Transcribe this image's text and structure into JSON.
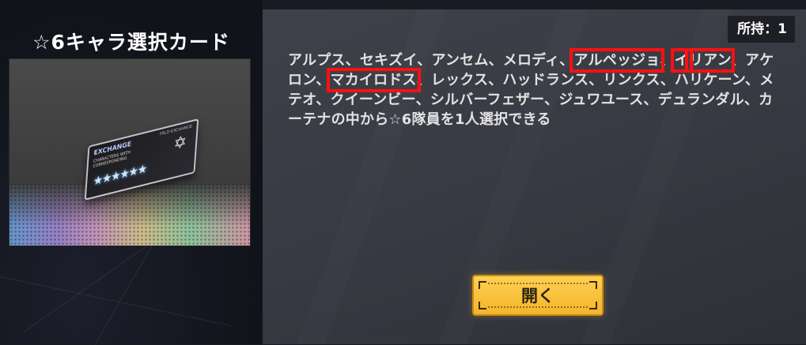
{
  "item": {
    "title": "☆6キャラ選択カード",
    "ticket_label": "EXCHANGE",
    "ticket_subtext": "CHARACTERS WITH CORRESPONDING",
    "ticket_code": "FRLD-EXCHANGE",
    "ticket_stars": "★★★★★★"
  },
  "owned": {
    "label": "所持：1"
  },
  "description": {
    "part1": "アルプス、セキズイ、アンセム、メロディ、",
    "hl1": "アルペッジョ",
    "sep1": "、",
    "hl2a": "イ",
    "hl2b": "リアン",
    "part2": "、アケロン、",
    "hl3": "マカイロドス",
    "part3": "、レックス、ハッドランス、リンクス、ハリケーン、メテオ、クイーンビー、シルバーフェザー、ジュワユース、デュランダル、カーテナの中から☆6隊員を1人選択できる"
  },
  "actions": {
    "open_label": "開く"
  },
  "colors": {
    "accent": "#f4b52a",
    "highlight": "#ff1010"
  }
}
